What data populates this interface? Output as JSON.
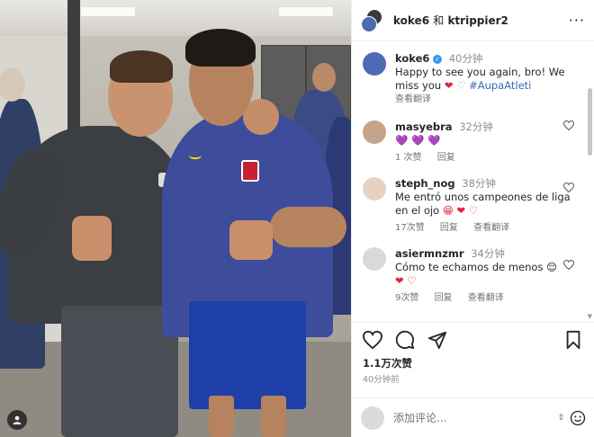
{
  "post": {
    "author": "koke6",
    "coauthor": "ktrippier2",
    "and_label": "和",
    "more_label": "···",
    "likes": "1.1万次赞",
    "time": "40分钟前"
  },
  "caption": {
    "user": "koke6",
    "time": "40分钟",
    "text": "Happy to see you again, bro! We miss you",
    "hashtag": "#AupaAtleti",
    "translate": "查看翻译"
  },
  "comments": [
    {
      "user": "masyebra",
      "time": "32分钟",
      "text": "",
      "emoji": "💜 💜 💜",
      "likes": "1 次赞",
      "reply": "回复",
      "translate": ""
    },
    {
      "user": "steph_nog",
      "time": "38分钟",
      "text": "Me entró unos campeones de liga en el ojo",
      "emoji": "😁 ❤ ♡",
      "likes": "17次赞",
      "reply": "回复",
      "translate": "查看翻译"
    },
    {
      "user": "asiermnzmr",
      "time": "34分钟",
      "text": "Cómo te echamos de menos",
      "emoji": "😌",
      "emoji2": "❤ ♡",
      "likes": "9次赞",
      "reply": "回复",
      "translate": "查看翻译"
    }
  ],
  "add_comment": {
    "placeholder": "添加评论..."
  },
  "icons": {
    "like": "heart-icon",
    "comment": "comment-icon",
    "share": "share-icon",
    "save": "bookmark-icon",
    "emoji": "emoji-icon"
  },
  "colors": {
    "verified": "#3897f0",
    "heart": "#e0243a",
    "purple_heart": "#8c5bd6",
    "muted": "#8e8e8e"
  }
}
